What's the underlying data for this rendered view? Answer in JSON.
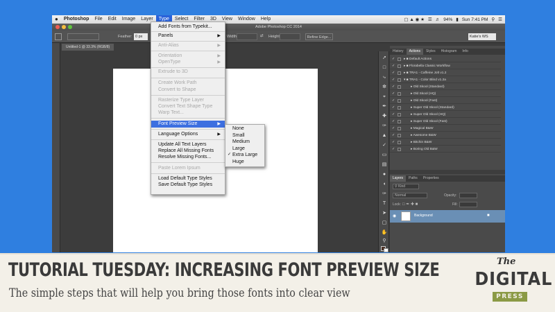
{
  "menubar": {
    "app_name": "Photoshop",
    "items": [
      "File",
      "Edit",
      "Image",
      "Layer",
      "Type",
      "Select",
      "Filter",
      "3D",
      "View",
      "Window",
      "Help"
    ],
    "active": "Type",
    "battery": "94%",
    "clock": "Sun 7:41 PM"
  },
  "window": {
    "title": "Adobe Photoshop CC 2014",
    "doc_tab": "Untitled-1 @ 33.3% (RGB/8)",
    "workspace": "Katie's WS"
  },
  "options_bar": {
    "feather_label": "Feather:",
    "feather_value": "0 px",
    "width_label": "Width:",
    "height_label": "Height:",
    "refine_edge": "Refine Edge..."
  },
  "type_menu": {
    "items": [
      {
        "label": "Add Fonts from Typekit...",
        "disabled": false
      },
      {
        "label": "Panels",
        "disabled": false,
        "submenu": true
      },
      {
        "label": "Anti-Alias",
        "disabled": true,
        "submenu": true
      },
      {
        "label": "Orientation",
        "disabled": true,
        "submenu": true
      },
      {
        "label": "OpenType",
        "disabled": true,
        "submenu": true
      },
      {
        "label": "Extrude to 3D",
        "disabled": true
      },
      {
        "label": "Create Work Path",
        "disabled": true
      },
      {
        "label": "Convert to Shape",
        "disabled": true
      },
      {
        "label": "Rasterize Type Layer",
        "disabled": true
      },
      {
        "label": "Convert Text Shape Type",
        "disabled": true
      },
      {
        "label": "Warp Text...",
        "disabled": true
      },
      {
        "label": "Font Preview Size",
        "disabled": false,
        "submenu": true,
        "highlighted": true
      },
      {
        "label": "Language Options",
        "disabled": false,
        "submenu": true
      },
      {
        "label": "Update All Text Layers",
        "disabled": false
      },
      {
        "label": "Replace All Missing Fonts",
        "disabled": false
      },
      {
        "label": "Resolve Missing Fonts...",
        "disabled": false
      },
      {
        "label": "Paste Lorem Ipsum",
        "disabled": true
      },
      {
        "label": "Load Default Type Styles",
        "disabled": false
      },
      {
        "label": "Save Default Type Styles",
        "disabled": false
      }
    ]
  },
  "font_preview_submenu": {
    "items": [
      "None",
      "Small",
      "Medium",
      "Large",
      "Extra Large",
      "Huge"
    ],
    "checked": "Extra Large"
  },
  "panels": {
    "top_tabs": [
      "History",
      "Actions",
      "Styles",
      "Histogram",
      "Info"
    ],
    "top_active": "Actions",
    "actions": [
      {
        "label": "Default Actions",
        "level": 0,
        "folder": true
      },
      {
        "label": "Florabella Classic Workflow",
        "level": 0,
        "folder": true
      },
      {
        "label": "TRA1 - Caffeine Jolt v1.2",
        "level": 0,
        "folder": true
      },
      {
        "label": "TRA1 - Color Blind v1.2a",
        "level": 0,
        "folder": true,
        "open": true
      },
      {
        "label": "Old Skool (Standard)",
        "level": 1
      },
      {
        "label": "Old Skool (HQ)",
        "level": 1
      },
      {
        "label": "Old Skool (Fast)",
        "level": 1
      },
      {
        "label": "Super Old Skool (Standard)",
        "level": 1
      },
      {
        "label": "Super Old Skool (HQ)",
        "level": 1
      },
      {
        "label": "Super Old Skool (Fast)",
        "level": 1
      },
      {
        "label": "Magical B&W",
        "level": 1
      },
      {
        "label": "Awesome B&W",
        "level": 1
      },
      {
        "label": "Bitchin B&W",
        "level": 1
      },
      {
        "label": "Boring Old B&W",
        "level": 1
      }
    ],
    "layer_tabs": [
      "Layers",
      "Paths",
      "Properties"
    ],
    "layer_active": "Layers",
    "kind_label": "Kind",
    "blend_mode": "Normal",
    "opacity_label": "Opacity:",
    "lock_label": "Lock:",
    "fill_label": "Fill:",
    "layer_name": "Background"
  },
  "banner": {
    "title": "TUTORIAL TUESDAY: INCREASING FONT PREVIEW SIZE",
    "subtitle": "The simple steps that will help you bring those fonts into clear view",
    "logo_the": "The",
    "logo_digital": "DIGITAL",
    "logo_press": "PRESS"
  },
  "colors": {
    "background": "#2f7fe0",
    "menu_highlight": "#3d6fe0",
    "logo_green": "#8b9a45",
    "banner_bg": "#f3f0e8"
  }
}
